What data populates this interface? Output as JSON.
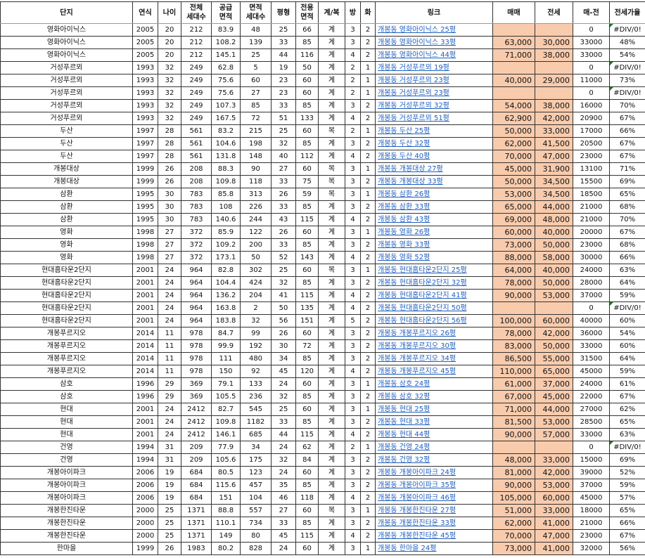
{
  "headers": [
    "단지",
    "연식",
    "나이",
    "전체\n세대수",
    "공급\n면적",
    "면적\n세대수",
    "평형",
    "전용\n면적",
    "계/복",
    "방",
    "화",
    "링크",
    "매매",
    "전세",
    "매-전",
    "전세가율"
  ],
  "colors": {
    "price_fill": "#f8cbad",
    "link": "#1f5fbf",
    "error_marker": "#1e7a1e"
  },
  "rows": [
    [
      "영화아이닉스",
      "2005",
      "20",
      "212",
      "83.9",
      "48",
      "25",
      "66",
      "계",
      "3",
      "2",
      "개봉동 영화아이닉스 25평",
      "",
      "",
      "0",
      "#DIV/0!"
    ],
    [
      "영화아이닉스",
      "2005",
      "20",
      "212",
      "108.2",
      "139",
      "33",
      "85",
      "계",
      "3",
      "2",
      "개봉동 영화아이닉스 33평",
      "63,000",
      "30,000",
      "33000",
      "48%"
    ],
    [
      "영화아이닉스",
      "2005",
      "20",
      "212",
      "145.1",
      "25",
      "44",
      "116",
      "계",
      "4",
      "2",
      "개봉동 영화아이닉스 44평",
      "71,000",
      "38,000",
      "33000",
      "54%"
    ],
    [
      "거성푸르뫼",
      "1993",
      "32",
      "249",
      "62.8",
      "5",
      "19",
      "50",
      "계",
      "2",
      "1",
      "개봉동 거성푸르뫼 19평",
      "",
      "",
      "0",
      "#DIV/0!"
    ],
    [
      "거성푸르뫼",
      "1993",
      "32",
      "249",
      "75.6",
      "60",
      "23",
      "60",
      "계",
      "2",
      "1",
      "개봉동 거성푸르뫼 23평",
      "40,000",
      "29,000",
      "11000",
      "73%"
    ],
    [
      "거성푸르뫼",
      "1993",
      "32",
      "249",
      "75.6",
      "27",
      "23",
      "60",
      "계",
      "2",
      "1",
      "개봉동 거성푸르뫼 23평",
      "",
      "",
      "0",
      "#DIV/0!"
    ],
    [
      "거성푸르뫼",
      "1993",
      "32",
      "249",
      "107.3",
      "85",
      "33",
      "85",
      "계",
      "3",
      "2",
      "개봉동 거성푸르뫼 32평",
      "54,000",
      "38,000",
      "16000",
      "70%"
    ],
    [
      "거성푸르뫼",
      "1993",
      "32",
      "249",
      "167.5",
      "72",
      "51",
      "133",
      "계",
      "4",
      "2",
      "개봉동 거성푸르뫼 51평",
      "62,900",
      "42,000",
      "20900",
      "67%"
    ],
    [
      "두산",
      "1997",
      "28",
      "561",
      "83.2",
      "215",
      "25",
      "60",
      "복",
      "2",
      "1",
      "개봉동 두산 25평",
      "50,000",
      "33,000",
      "17000",
      "66%"
    ],
    [
      "두산",
      "1997",
      "28",
      "561",
      "104.6",
      "198",
      "32",
      "85",
      "계",
      "3",
      "2",
      "개봉동 두산 32평",
      "62,000",
      "41,500",
      "20500",
      "67%"
    ],
    [
      "두산",
      "1997",
      "28",
      "561",
      "131.8",
      "148",
      "40",
      "112",
      "계",
      "4",
      "2",
      "개봉동 두산 40평",
      "70,000",
      "47,000",
      "23000",
      "67%"
    ],
    [
      "개봉대상",
      "1999",
      "26",
      "208",
      "88.3",
      "90",
      "27",
      "60",
      "복",
      "3",
      "1",
      "개봉동 개봉대상 27평",
      "45,000",
      "31,900",
      "13100",
      "71%"
    ],
    [
      "개봉대상",
      "1999",
      "26",
      "208",
      "109.8",
      "118",
      "33",
      "75",
      "복",
      "3",
      "2",
      "개봉동 개봉대상 33평",
      "50,000",
      "34,500",
      "15500",
      "69%"
    ],
    [
      "삼환",
      "1995",
      "30",
      "783",
      "85.8",
      "313",
      "26",
      "59",
      "복",
      "3",
      "1",
      "개봉동 삼환 26평",
      "53,000",
      "34,500",
      "18500",
      "65%"
    ],
    [
      "삼환",
      "1995",
      "30",
      "783",
      "108",
      "226",
      "33",
      "85",
      "계",
      "3",
      "2",
      "개봉동 삼환 33평",
      "65,000",
      "44,000",
      "21000",
      "68%"
    ],
    [
      "삼환",
      "1995",
      "30",
      "783",
      "140.6",
      "244",
      "43",
      "115",
      "계",
      "4",
      "2",
      "개봉동 삼환 43평",
      "69,000",
      "48,000",
      "21000",
      "70%"
    ],
    [
      "영화",
      "1998",
      "27",
      "372",
      "85.9",
      "122",
      "26",
      "60",
      "계",
      "3",
      "1",
      "개봉동 영화 26평",
      "60,000",
      "40,000",
      "20000",
      "67%"
    ],
    [
      "영화",
      "1998",
      "27",
      "372",
      "109.2",
      "200",
      "33",
      "85",
      "계",
      "3",
      "2",
      "개봉동 영화 33평",
      "73,000",
      "50,000",
      "23000",
      "68%"
    ],
    [
      "영화",
      "1998",
      "27",
      "372",
      "173.1",
      "50",
      "52",
      "143",
      "계",
      "4",
      "2",
      "개봉동 영화 52평",
      "88,000",
      "58,000",
      "30000",
      "66%"
    ],
    [
      "현대홈타운2단지",
      "2001",
      "24",
      "964",
      "82.8",
      "302",
      "25",
      "60",
      "복",
      "3",
      "1",
      "개봉동 현대홈타운2단지 25평",
      "64,000",
      "40,000",
      "24000",
      "63%"
    ],
    [
      "현대홈타운2단지",
      "2001",
      "24",
      "964",
      "104.4",
      "424",
      "32",
      "85",
      "계",
      "3",
      "2",
      "개봉동 현대홈타운2단지 32평",
      "78,000",
      "50,000",
      "28000",
      "64%"
    ],
    [
      "현대홈타운2단지",
      "2001",
      "24",
      "964",
      "136.2",
      "204",
      "41",
      "115",
      "계",
      "4",
      "2",
      "개봉동 현대홈타운2단지 41평",
      "90,000",
      "53,000",
      "37000",
      "59%"
    ],
    [
      "현대홈타운2단지",
      "2001",
      "24",
      "964",
      "163.8",
      "2",
      "50",
      "135",
      "계",
      "4",
      "2",
      "개봉동 현대홈타운2단지 50평",
      "",
      "",
      "0",
      "#DIV/0!"
    ],
    [
      "현대홈타운2단지",
      "2001",
      "24",
      "964",
      "183.8",
      "32",
      "56",
      "151",
      "계",
      "5",
      "2",
      "개봉동 현대홈타운2단지 56평",
      "100,000",
      "60,000",
      "40000",
      "60%"
    ],
    [
      "개봉푸르지오",
      "2014",
      "11",
      "978",
      "84.7",
      "99",
      "26",
      "60",
      "계",
      "3",
      "2",
      "개봉동 개봉푸르지오 26평",
      "78,000",
      "42,000",
      "36000",
      "54%"
    ],
    [
      "개봉푸르지오",
      "2014",
      "11",
      "978",
      "99.9",
      "192",
      "30",
      "72",
      "계",
      "3",
      "2",
      "개봉동 개봉푸르지오 30평",
      "83,000",
      "50,000",
      "33000",
      "60%"
    ],
    [
      "개봉푸르지오",
      "2014",
      "11",
      "978",
      "111",
      "480",
      "34",
      "85",
      "계",
      "3",
      "2",
      "개봉동 개봉푸르지오 34평",
      "86,500",
      "55,000",
      "31500",
      "64%"
    ],
    [
      "개봉푸르지오",
      "2014",
      "11",
      "978",
      "150",
      "92",
      "45",
      "120",
      "계",
      "4",
      "2",
      "개봉동 개봉푸르지오 45평",
      "110,000",
      "65,000",
      "45000",
      "59%"
    ],
    [
      "삼호",
      "1996",
      "29",
      "369",
      "79.1",
      "133",
      "24",
      "60",
      "계",
      "3",
      "1",
      "개봉동 삼호 24평",
      "61,000",
      "37,000",
      "24000",
      "61%"
    ],
    [
      "삼호",
      "1996",
      "29",
      "369",
      "105.5",
      "236",
      "32",
      "85",
      "계",
      "3",
      "2",
      "개봉동 삼호 32평",
      "67,000",
      "45,000",
      "22000",
      "67%"
    ],
    [
      "현대",
      "2001",
      "24",
      "2412",
      "82.7",
      "545",
      "25",
      "60",
      "계",
      "3",
      "1",
      "개봉동 현대 25평",
      "71,000",
      "44,000",
      "27000",
      "62%"
    ],
    [
      "현대",
      "2001",
      "24",
      "2412",
      "109.8",
      "1182",
      "33",
      "85",
      "계",
      "3",
      "2",
      "개봉동 현대 33평",
      "81,500",
      "53,000",
      "28500",
      "65%"
    ],
    [
      "현대",
      "2001",
      "24",
      "2412",
      "146.1",
      "685",
      "44",
      "115",
      "계",
      "4",
      "2",
      "개봉동 현대 44평",
      "90,000",
      "57,000",
      "33000",
      "63%"
    ],
    [
      "건영",
      "1994",
      "31",
      "209",
      "77.9",
      "34",
      "24",
      "62",
      "계",
      "2",
      "1",
      "개봉동 건영 24평",
      "",
      "",
      "0",
      "#DIV/0!"
    ],
    [
      "건영",
      "1994",
      "31",
      "209",
      "105.6",
      "175",
      "32",
      "84",
      "계",
      "3",
      "2",
      "개봉동 건영 32평",
      "48,000",
      "33,000",
      "15000",
      "69%"
    ],
    [
      "개봉아이파크",
      "2006",
      "19",
      "684",
      "80.5",
      "123",
      "24",
      "60",
      "계",
      "3",
      "2",
      "개봉동 개봉아이파크 24평",
      "81,000",
      "42,000",
      "39000",
      "52%"
    ],
    [
      "개봉아이파크",
      "2006",
      "19",
      "684",
      "115.6",
      "457",
      "35",
      "85",
      "계",
      "3",
      "2",
      "개봉동 개봉아이파크 35평",
      "90,000",
      "53,000",
      "37000",
      "59%"
    ],
    [
      "개봉아이파크",
      "2006",
      "19",
      "684",
      "151",
      "104",
      "46",
      "118",
      "계",
      "4",
      "2",
      "개봉동 개봉아이파크 46평",
      "105,000",
      "60,000",
      "45000",
      "57%"
    ],
    [
      "개봉한진타운",
      "2000",
      "25",
      "1371",
      "88.8",
      "557",
      "27",
      "60",
      "복",
      "3",
      "1",
      "개봉동 개봉한진타운 27평",
      "51,000",
      "33,000",
      "18000",
      "65%"
    ],
    [
      "개봉한진타운",
      "2000",
      "25",
      "1371",
      "110.1",
      "734",
      "33",
      "85",
      "계",
      "3",
      "2",
      "개봉동 개봉한진타운 33평",
      "62,000",
      "41,000",
      "21000",
      "66%"
    ],
    [
      "개봉한진타운",
      "2000",
      "25",
      "1371",
      "149",
      "80",
      "45",
      "115",
      "계",
      "4",
      "2",
      "개봉동 개봉한진타운 45평",
      "70,000",
      "47,000",
      "23000",
      "67%"
    ],
    [
      "한마을",
      "1999",
      "26",
      "1983",
      "80.2",
      "828",
      "24",
      "60",
      "계",
      "3",
      "1",
      "개봉동 한마을 24평",
      "73,000",
      "41,000",
      "32000",
      "56%"
    ]
  ]
}
